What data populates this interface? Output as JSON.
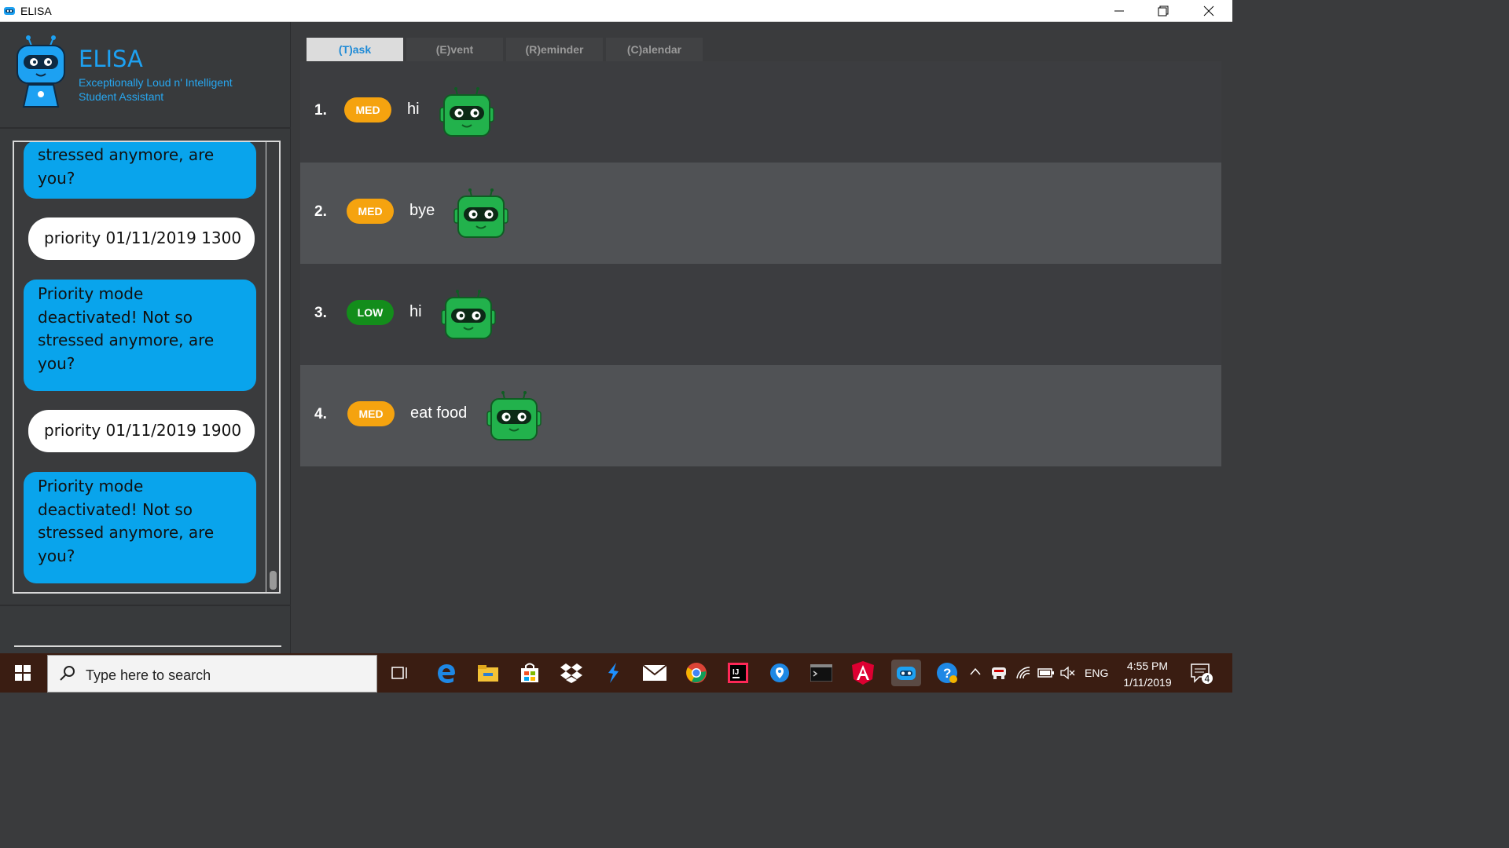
{
  "window": {
    "title": "ELISA",
    "icons": [
      "app-icon",
      "minimize-icon",
      "maximize-icon",
      "close-icon"
    ]
  },
  "brand": {
    "name": "ELISA",
    "subtitle_line1": "Exceptionally Loud n' Intelligent",
    "subtitle_line2": "Student Assistant"
  },
  "chat": {
    "messages": [
      {
        "from": "elisa",
        "lines": [
          "stressed anymore, are",
          "you?"
        ]
      },
      {
        "from": "user",
        "text": "priority 01/11/2019 1300"
      },
      {
        "from": "elisa",
        "lines": [
          "Priority mode",
          "deactivated! Not so",
          "stressed anymore, are",
          "you?"
        ]
      },
      {
        "from": "user",
        "text": "priority 01/11/2019 1900"
      },
      {
        "from": "elisa",
        "lines": [
          "Priority mode",
          "deactivated! Not so",
          "stressed anymore, are",
          "you?"
        ]
      }
    ]
  },
  "tabs": [
    {
      "label": "(T)ask",
      "active": true
    },
    {
      "label": "(E)vent",
      "active": false
    },
    {
      "label": "(R)eminder",
      "active": false
    },
    {
      "label": "(C)alendar",
      "active": false
    }
  ],
  "tasks": [
    {
      "index": "1.",
      "priority": "MED",
      "description": "hi"
    },
    {
      "index": "2.",
      "priority": "MED",
      "description": "bye"
    },
    {
      "index": "3.",
      "priority": "LOW",
      "description": "hi"
    },
    {
      "index": "4.",
      "priority": "MED",
      "description": "eat food"
    }
  ],
  "colors": {
    "accent": "#1da1f2",
    "elisa_bubble": "#09a4ec",
    "priority_med": "#f5a30f",
    "priority_low": "#138d1b",
    "robot_green": "#22b24c"
  },
  "taskbar": {
    "search_placeholder": "Type here to search",
    "apps": [
      "task-view-icon",
      "edge-icon",
      "file-explorer-icon",
      "store-icon",
      "dropbox-icon",
      "visual-studio-code-icon",
      "mail-icon",
      "chrome-icon",
      "intellij-icon",
      "maps-icon",
      "terminal-icon",
      "angular-icon",
      "elisa-app-icon",
      "help-icon"
    ],
    "language": "ENG",
    "time": "4:55 PM",
    "date": "1/11/2019",
    "notification_count": "4"
  }
}
